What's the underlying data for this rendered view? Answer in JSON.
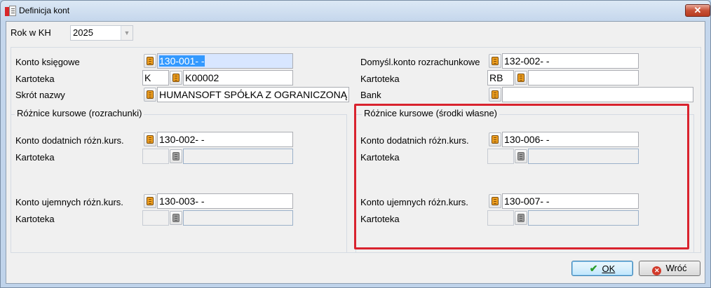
{
  "window": {
    "title": "Definicja kont",
    "close_glyph": "✕"
  },
  "year": {
    "label": "Rok w KH",
    "value": "2025"
  },
  "left": {
    "konto_ksiegowe_label": "Konto księgowe",
    "konto_ksiegowe_value": "130-001-   -",
    "kartoteka_label": "Kartoteka",
    "kartoteka_type": "K",
    "kartoteka_value": "K00002",
    "skrot_label": "Skrót nazwy",
    "skrot_value": "HUMANSOFT SPÓŁKA Z OGRANICZONĄ"
  },
  "right": {
    "domyslne_label": "Domyśl.konto rozrachunkowe",
    "domyslne_value": "132-002-   -",
    "kartoteka_label": "Kartoteka",
    "kartoteka_type": "RB",
    "kartoteka_value": "",
    "bank_label": "Bank",
    "bank_value": ""
  },
  "group_rozrachunki": {
    "title": "Różnice kursowe (rozrachunki)",
    "dodatnie_label": "Konto dodatnich różn.kurs.",
    "dodatnie_value": "130-002-   -",
    "kartoteka1_label": "Kartoteka",
    "ujemne_label": "Konto ujemnych różn.kurs.",
    "ujemne_value": "130-003-   -",
    "kartoteka2_label": "Kartoteka"
  },
  "group_srodki": {
    "title": "Różnice kursowe (środki własne)",
    "dodatnie_label": "Konto dodatnich różn.kurs.",
    "dodatnie_value": "130-006-   -",
    "kartoteka1_label": "Kartoteka",
    "ujemne_label": "Konto ujemnych różn.kurs.",
    "ujemne_value": "130-007-   -",
    "kartoteka2_label": "Kartoteka"
  },
  "buttons": {
    "ok": "OK",
    "cancel": "Wróć"
  },
  "colors": {
    "highlight": "#d9232e",
    "accent": "#3399ff"
  }
}
